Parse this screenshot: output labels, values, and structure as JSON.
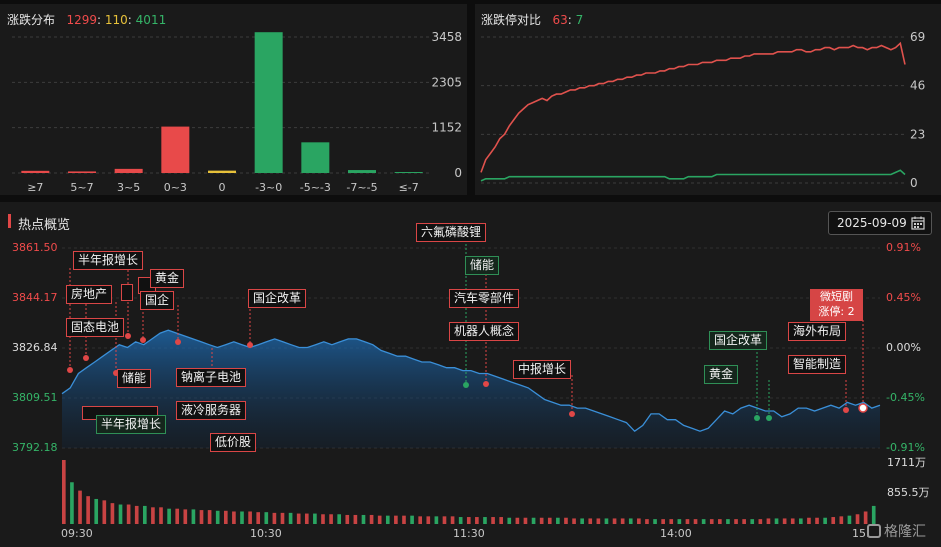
{
  "dist": {
    "title": "涨跌分布",
    "up": "1299",
    "flat": "110",
    "down": "4011",
    "sep": ":",
    "yticks": [
      "3458",
      "2305",
      "1152",
      "0"
    ],
    "chart_data": {
      "type": "bar",
      "categories": [
        "≥7",
        "5~7",
        "3~5",
        "0~3",
        "0",
        "-3~0",
        "-5~-3",
        "-7~-5",
        "≤-7"
      ],
      "values": [
        55,
        40,
        105,
        1180,
        60,
        3580,
        780,
        75,
        25
      ],
      "ylim": [
        0,
        3458
      ],
      "colors": [
        "#e84a4a",
        "#e84a4a",
        "#e84a4a",
        "#e84a4a",
        "#e7c13a",
        "#2aa562",
        "#2aa562",
        "#2aa562",
        "#2aa562"
      ]
    }
  },
  "ratio": {
    "title": "涨跌停对比",
    "up": "63",
    "down": "7",
    "sep": ":",
    "yticks": [
      "69",
      "46",
      "23",
      "0"
    ],
    "chart_data": {
      "type": "line",
      "ylim": [
        0,
        69
      ],
      "series": [
        {
          "color": "#e0524d",
          "values": [
            5,
            11,
            14,
            17,
            21,
            23,
            27,
            30,
            33,
            35,
            37,
            38,
            39,
            40,
            39,
            41,
            42,
            42,
            43,
            44,
            44,
            45,
            45,
            46,
            46,
            47,
            47,
            48,
            48,
            49,
            49,
            50,
            50,
            51,
            51,
            52,
            52,
            52,
            53,
            53,
            54,
            54,
            55,
            55,
            56,
            56,
            56,
            57,
            57,
            57,
            58,
            58,
            58,
            59,
            59,
            59,
            60,
            60,
            61,
            61,
            61,
            61,
            61,
            62,
            62,
            62,
            62,
            63,
            63,
            62,
            62,
            63,
            63,
            64,
            64,
            63,
            64,
            64,
            64,
            65,
            64,
            64,
            63,
            64,
            64,
            65,
            64,
            63,
            64,
            66,
            56
          ]
        },
        {
          "color": "#2aa562",
          "values": [
            1,
            2,
            2,
            2,
            2,
            2,
            3,
            3,
            3,
            3,
            3,
            3,
            3,
            3,
            3,
            3,
            3,
            3,
            3,
            3,
            3,
            3,
            3,
            3,
            3,
            3,
            3,
            3,
            3,
            3,
            3,
            3,
            3,
            3,
            3,
            3,
            3,
            3,
            3,
            3,
            2,
            2,
            2,
            2,
            3,
            3,
            3,
            3,
            3,
            3,
            4,
            4,
            4,
            4,
            4,
            4,
            4,
            4,
            4,
            4,
            4,
            4,
            4,
            4,
            4,
            4,
            4,
            4,
            4,
            4,
            4,
            4,
            4,
            4,
            4,
            4,
            4,
            4,
            4,
            4,
            4,
            4,
            4,
            4,
            4,
            4,
            4,
            4,
            5,
            6,
            4
          ]
        }
      ]
    }
  },
  "main": {
    "title": "热点概览",
    "date": "2025-09-09",
    "ylabels_left": [
      "3861.50",
      "3844.17",
      "3826.84",
      "3809.51",
      "3792.18"
    ],
    "ylabels_right": [
      "0.91%",
      "0.45%",
      "0.00%",
      "-0.45%",
      "-0.91%"
    ],
    "vol_labels": [
      "1711万",
      "855.5万"
    ],
    "times": [
      "09:30",
      "10:30",
      "11:30",
      "14:00",
      "15:"
    ],
    "limit_box": {
      "line1": "微短剧",
      "line2": "涨停: 2"
    },
    "watermark": "格隆汇",
    "tags": [
      {
        "t": "半年报增长"
      },
      {
        "t": "房地产"
      },
      {
        "t": "固态电池"
      },
      {
        "t": "黄金"
      },
      {
        "t": "国企"
      },
      {
        "t": "国企改革"
      },
      {
        "t": "储能"
      },
      {
        "t": "钠离子电池"
      },
      {
        "t": "液冷服务器"
      },
      {
        "t": "低价股"
      },
      {
        "t": "半年报增长"
      },
      {
        "t": "六氟磷酸锂"
      },
      {
        "t": "储能"
      },
      {
        "t": "汽车零部件"
      },
      {
        "t": "机器人概念"
      },
      {
        "t": "中报增长"
      },
      {
        "t": "国企改革"
      },
      {
        "t": "黄金"
      },
      {
        "t": "海外布局"
      },
      {
        "t": "智能制造"
      }
    ],
    "chart_data": {
      "type": "area",
      "ylim": [
        3792.18,
        3861.5
      ],
      "values": [
        3811,
        3813,
        3818,
        3820,
        3822,
        3824,
        3826,
        3828,
        3827,
        3829,
        3828,
        3830,
        3832,
        3833,
        3832,
        3831,
        3830,
        3829,
        3828,
        3827,
        3828,
        3829,
        3828,
        3827,
        3828,
        3829,
        3830,
        3829,
        3828,
        3827,
        3827,
        3828,
        3829,
        3828,
        3829,
        3830,
        3830,
        3829,
        3828,
        3826,
        3825,
        3824,
        3824,
        3823,
        3822,
        3822,
        3821,
        3820,
        3820,
        3819,
        3819,
        3818,
        3818,
        3817,
        3816,
        3815,
        3814,
        3813,
        3811,
        3809,
        3808,
        3807,
        3807,
        3806,
        3806,
        3805,
        3804,
        3803,
        3802,
        3801,
        3798,
        3800,
        3804,
        3804,
        3802,
        3802,
        3800,
        3799,
        3798,
        3799,
        3802,
        3805,
        3804,
        3806,
        3807,
        3806,
        3805,
        3805,
        3803,
        3804,
        3806,
        3806,
        3805,
        3806,
        3807,
        3806,
        3808,
        3807,
        3808,
        3806,
        3807
      ],
      "volumes": [
        92,
        60,
        48,
        40,
        36,
        34,
        30,
        28,
        28,
        26,
        26,
        24,
        24,
        22,
        22,
        21,
        21,
        20,
        20,
        19,
        19,
        18,
        18,
        18,
        17,
        17,
        16,
        16,
        16,
        15,
        15,
        15,
        14,
        14,
        14,
        13,
        13,
        13,
        13,
        12,
        12,
        12,
        12,
        12,
        11,
        11,
        11,
        11,
        11,
        10,
        10,
        10,
        10,
        10,
        10,
        9,
        9,
        9,
        9,
        9,
        9,
        9,
        9,
        8,
        8,
        8,
        8,
        8,
        8,
        8,
        8,
        8,
        7,
        7,
        7,
        7,
        7,
        7,
        7,
        7,
        7,
        7,
        7,
        7,
        7,
        7,
        7,
        8,
        8,
        8,
        8,
        8,
        9,
        9,
        9,
        10,
        11,
        12,
        14,
        18,
        26
      ]
    }
  }
}
